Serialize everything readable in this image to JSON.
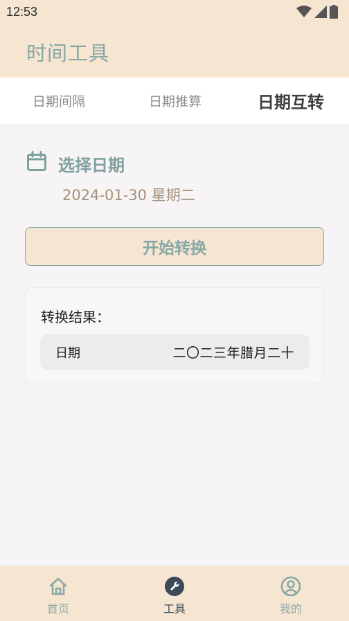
{
  "status_bar": {
    "time": "12:53",
    "icons": [
      "wifi-icon",
      "signal-icon",
      "battery-icon"
    ]
  },
  "app_bar": {
    "title": "时间工具"
  },
  "tabs": [
    {
      "label": "日期间隔",
      "active": false
    },
    {
      "label": "日期推算",
      "active": false
    },
    {
      "label": "日期互转",
      "active": true
    }
  ],
  "date_section": {
    "icon": "calendar-icon",
    "title": "选择日期",
    "value": "2024-01-30 星期二"
  },
  "convert_button": {
    "label": "开始转换"
  },
  "result": {
    "heading": "转换结果：",
    "row_label": "日期",
    "row_value": "二〇二三年腊月二十"
  },
  "bottom_nav": [
    {
      "label": "首页",
      "icon": "home-icon",
      "active": false
    },
    {
      "label": "工具",
      "icon": "wrench-icon",
      "active": true
    },
    {
      "label": "我的",
      "icon": "profile-icon",
      "active": false
    }
  ],
  "colors": {
    "accent": "#86a8a6",
    "header_bg": "#f5e5d1",
    "page_bg": "#f7f4f5",
    "date_text": "#a4907a",
    "active_nav": "#3a4a56"
  }
}
